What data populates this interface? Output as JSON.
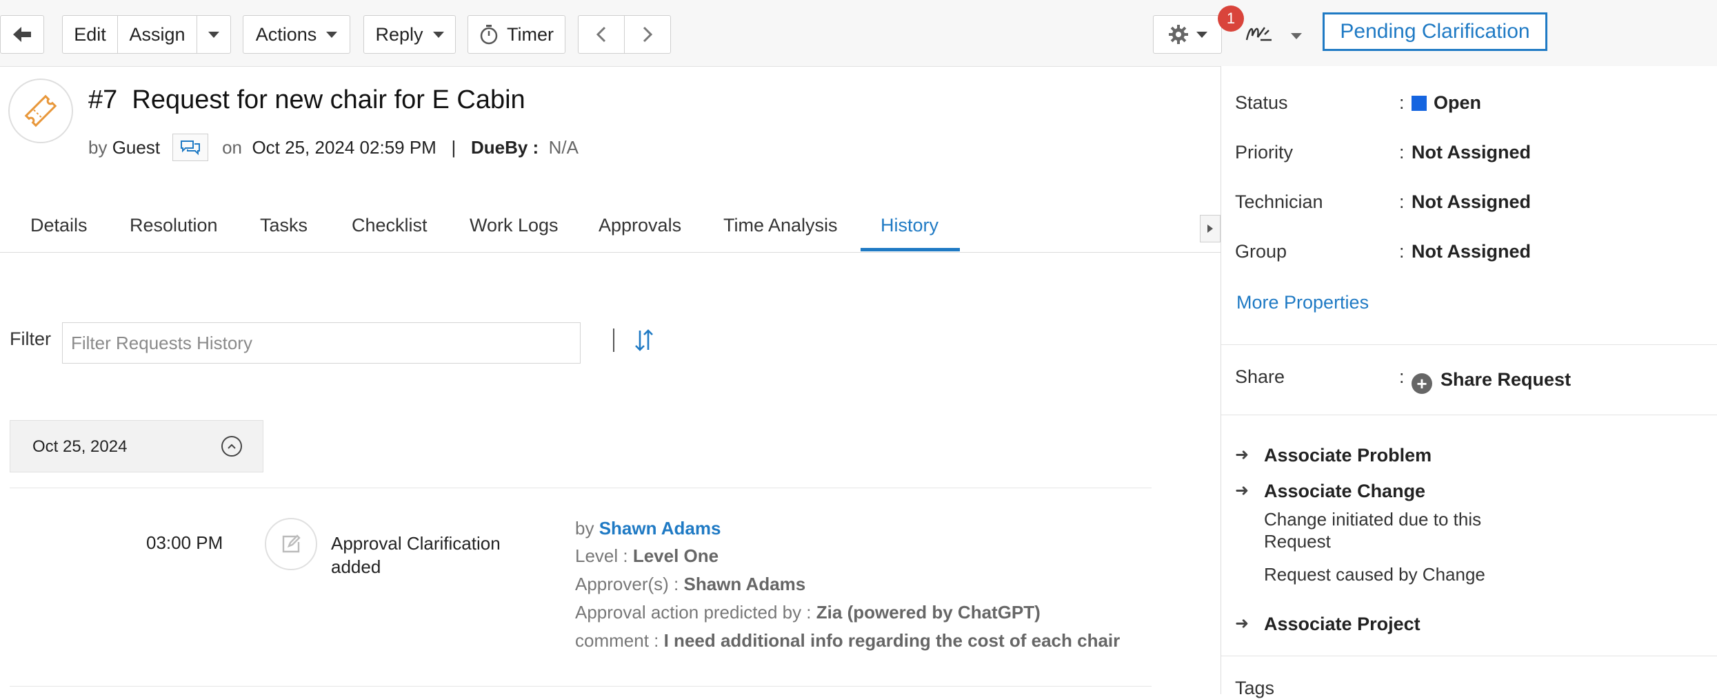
{
  "toolbar": {
    "edit": "Edit",
    "assign": "Assign",
    "actions": "Actions",
    "reply": "Reply",
    "timer": "Timer",
    "notification_count": "1",
    "status_button": "Pending Clarification"
  },
  "request": {
    "number": "#7",
    "title": "Request for new chair for E Cabin",
    "by_label": "by",
    "requester": "Guest",
    "on_label": "on",
    "created": "Oct 25, 2024 02:59 PM",
    "sep": "|",
    "dueby_label": "DueBy :",
    "dueby_value": "N/A"
  },
  "tabs": [
    {
      "label": "Details"
    },
    {
      "label": "Resolution"
    },
    {
      "label": "Tasks"
    },
    {
      "label": "Checklist"
    },
    {
      "label": "Work Logs"
    },
    {
      "label": "Approvals"
    },
    {
      "label": "Time Analysis"
    },
    {
      "label": "History"
    }
  ],
  "filter": {
    "label": "Filter",
    "placeholder": "Filter Requests History"
  },
  "history": {
    "date": "Oct 25, 2024",
    "entry": {
      "time": "03:00 PM",
      "action": "Approval Clarification added",
      "by_label": "by",
      "by_name": "Shawn Adams",
      "level_label": "Level :",
      "level_value": "Level One",
      "approvers_label": "Approver(s) :",
      "approvers_value": "Shawn Adams",
      "predicted_label": "Approval action predicted by :",
      "predicted_value": "Zia (powered by ChatGPT)",
      "comment_label": "comment :",
      "comment_value": "I need additional info regarding the cost of each chair"
    }
  },
  "properties": {
    "status_label": "Status",
    "status_value": "Open",
    "status_color": "#1565e0",
    "priority_label": "Priority",
    "priority_value": "Not Assigned",
    "technician_label": "Technician",
    "technician_value": "Not Assigned",
    "group_label": "Group",
    "group_value": "Not Assigned",
    "colon": ":",
    "more": "More Properties",
    "share_label": "Share",
    "share_value": "Share Request",
    "associate_problem": "Associate Problem",
    "associate_change": "Associate Change",
    "change_initiated": "Change initiated due to this Request",
    "caused_by_change": "Request caused by Change",
    "associate_project": "Associate Project",
    "tags_label": "Tags"
  },
  "colors": {
    "accent": "#1f7ac4",
    "badge": "#d9443b",
    "ticket_icon": "#e8973a"
  }
}
